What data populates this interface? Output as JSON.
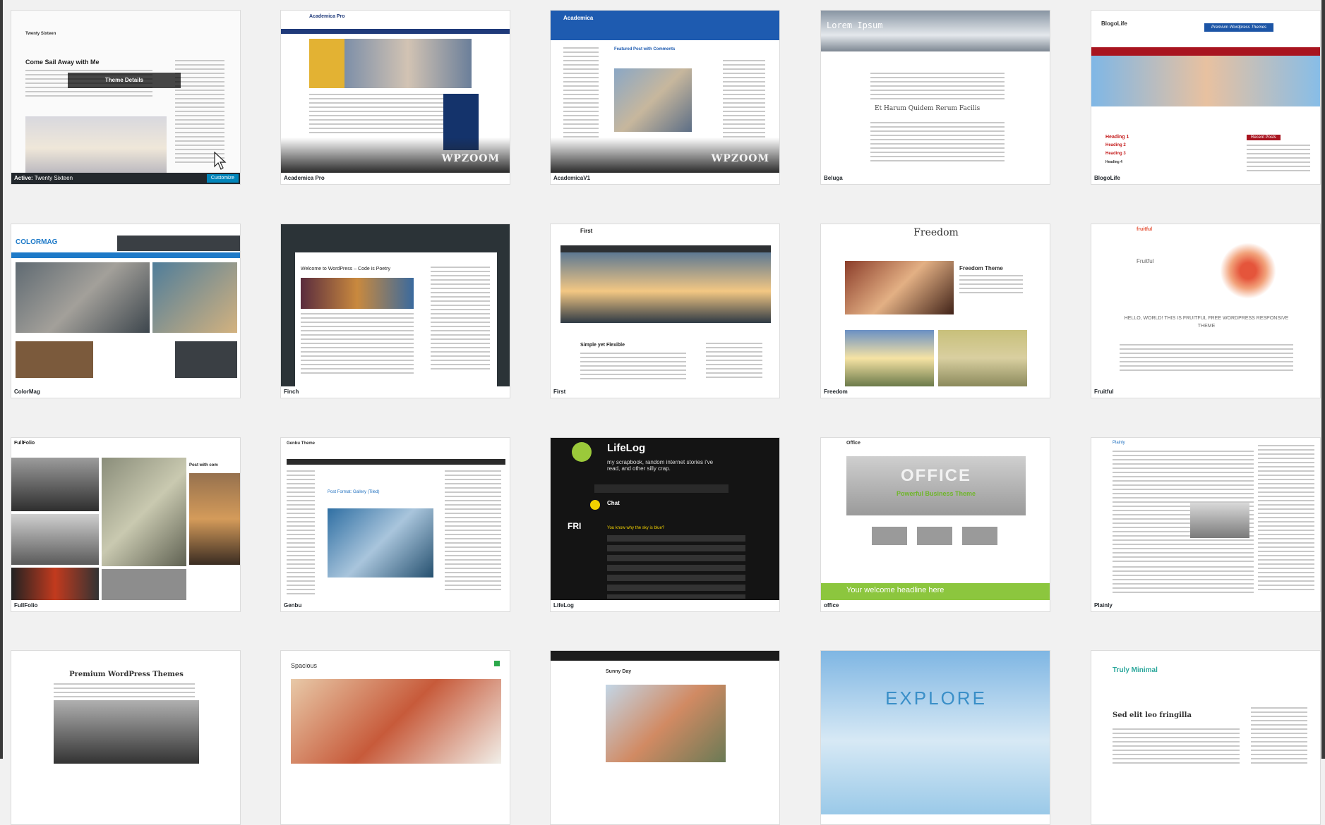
{
  "active_label": "Active:",
  "theme_details_label": "Theme Details",
  "customize_label": "Customize",
  "watermark": "WPZOOM",
  "themes": [
    {
      "name": "Twenty Sixteen",
      "headline": "Come Sail Away with Me"
    },
    {
      "name": "Academica Pro",
      "headline": "Academica Pro"
    },
    {
      "name": "AcademicaV1",
      "headline": "Academica",
      "post": "Featured Post with Comments"
    },
    {
      "name": "Beluga",
      "headline": "Lorem Ipsum",
      "post": "Et Harum Quidem Rerum Facilis"
    },
    {
      "name": "BlogoLife",
      "headline": "BlogoLife",
      "badge": "Premium Wordpress Themes",
      "h1": "Heading 1",
      "h2": "Heading 2",
      "h3": "Heading 3",
      "h4": "Heading 4",
      "side": "Recent Posts"
    },
    {
      "name": "ColorMag",
      "headline": "COLORMAG"
    },
    {
      "name": "Finch",
      "headline": "Welcome to WordPress – Code is Poetry"
    },
    {
      "name": "First",
      "headline": "First",
      "post": "Simple yet Flexible"
    },
    {
      "name": "Freedom",
      "headline": "Freedom",
      "post": "Freedom Theme"
    },
    {
      "name": "Fruitful",
      "headline": "Fruitful",
      "post": "HELLO, WORLD! THIS IS FRUITFUL FREE WORDPRESS RESPONSIVE THEME"
    },
    {
      "name": "FullFolio",
      "headline": "FullFolio",
      "post": "Post with com"
    },
    {
      "name": "Genbu",
      "headline": "Genbu Theme",
      "post": "Post Format: Gallery (Tiled)"
    },
    {
      "name": "LifeLog",
      "headline": "LifeLog",
      "tagline": "my scrapbook, random internet stories i've read, and other silly crap.",
      "post": "Chat",
      "day": "FRI",
      "q": "You know why the sky is blue?"
    },
    {
      "name": "office",
      "headline": "OFFICE",
      "sub": "Powerful Business Theme",
      "welcome": "Your welcome headline here"
    },
    {
      "name": "Plainly",
      "headline": "Plainly"
    },
    {
      "name": "",
      "headline": "Premium WordPress Themes"
    },
    {
      "name": "",
      "headline": "Spacious"
    },
    {
      "name": "",
      "headline": "Sunny Day"
    },
    {
      "name": "",
      "headline": "EXPLORE"
    },
    {
      "name": "",
      "headline": "Truly Minimal",
      "post": "Sed elit leo fringilla"
    }
  ]
}
